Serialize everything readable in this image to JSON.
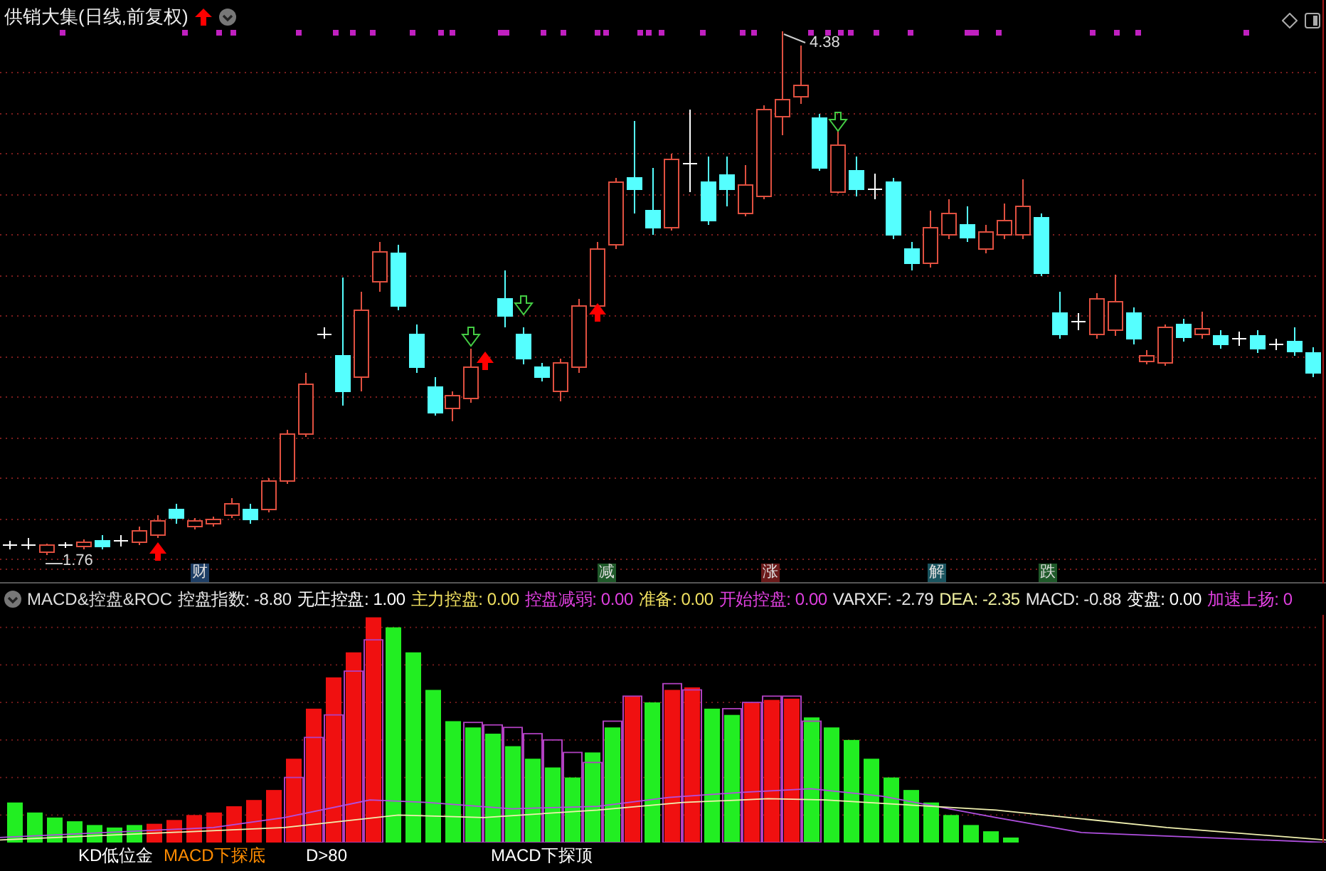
{
  "header": {
    "title": "供销大集(日线,前复权)"
  },
  "price_labels": [
    {
      "text": "4.38"
    },
    {
      "text": "1.76"
    }
  ],
  "event_markers": [
    {
      "text": "财",
      "color": "#1e3f66"
    },
    {
      "text": "减",
      "color": "#1f5a2a"
    },
    {
      "text": "涨",
      "color": "#6b1a1a"
    },
    {
      "text": "解",
      "color": "#1a5560"
    },
    {
      "text": "跌",
      "color": "#1f5a2a"
    }
  ],
  "indicator": {
    "name": "MACD&控盘&ROC",
    "values": [
      {
        "text": "控盘指数: -8.80",
        "color": "#e6e6e6"
      },
      {
        "text": "无庄控盘: 1.00",
        "color": "#ffffff"
      },
      {
        "text": "主力控盘: 0.00",
        "color": "#f0e060"
      },
      {
        "text": "控盘减弱: 0.00",
        "color": "#e040e0"
      },
      {
        "text": "准备: 0.00",
        "color": "#f0e060"
      },
      {
        "text": "开始控盘: 0.00",
        "color": "#e040e0"
      },
      {
        "text": "VARXF: -2.79",
        "color": "#e6e6e6"
      },
      {
        "text": "DEA: -2.35",
        "color": "#f0f0a0"
      },
      {
        "text": "MACD: -0.88",
        "color": "#e6e6e6"
      },
      {
        "text": "变盘: 0.00",
        "color": "#ffffff"
      },
      {
        "text": "加速上扬: 0",
        "color": "#e040e0"
      }
    ]
  },
  "signal_labels": [
    {
      "text": "KD低位金",
      "color": "#ffffff"
    },
    {
      "text": "MACD下探底",
      "color": "#ff8c00"
    },
    {
      "text": "D>80",
      "color": "#ffffff"
    },
    {
      "text": "MACD下探顶",
      "color": "#ffffff"
    }
  ]
}
